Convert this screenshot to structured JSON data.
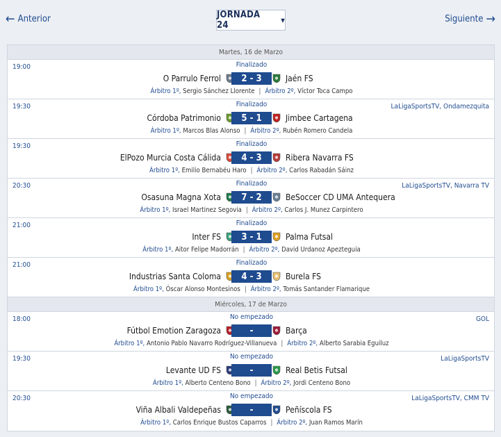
{
  "nav": {
    "prev_label": "Anterior",
    "next_label": "Siguiente",
    "round_label": "JORNADA 24"
  },
  "days": [
    {
      "label": "Martes, 16 de Marzo",
      "matches": [
        {
          "time": "19:00",
          "status": "Finalizado",
          "home": "O Parrulo Ferrol",
          "away": "Jaén FS",
          "score": "2 - 3",
          "tv": "",
          "ref1_label": "Árbitro 1º,",
          "ref1": "Sergio Sánchez Llorente",
          "ref2_label": "Árbitro 2º,",
          "ref2": "Víctor Toca Campo",
          "home_color": "#6b7a8c",
          "away_color": "#2a7a3a"
        },
        {
          "time": "19:30",
          "status": "Finalizado",
          "home": "Córdoba Patrimonio",
          "away": "Jimbee Cartagena",
          "score": "5 - 1",
          "tv": "LaLigaSportsTV, Ondamezquita",
          "ref1_label": "Árbitro 1º,",
          "ref1": "Marcos Blas Alonso",
          "ref2_label": "Árbitro 2º,",
          "ref2": "Rubén Romero Candela",
          "home_color": "#6a9a2c",
          "away_color": "#c0201f"
        },
        {
          "time": "19:30",
          "status": "Finalizado",
          "home": "ElPozo Murcia Costa Cálida",
          "away": "Ribera Navarra FS",
          "score": "4 - 3",
          "tv": "",
          "ref1_label": "Árbitro 1º,",
          "ref1": "Emilio Bernabéu Haro",
          "ref2_label": "Árbitro 2º,",
          "ref2": "Carlos Rabadán Sáinz",
          "home_color": "#d9493a",
          "away_color": "#b83a3a"
        },
        {
          "time": "20:30",
          "status": "Finalizado",
          "home": "Osasuna Magna Xota",
          "away": "BeSoccer CD UMA Antequera",
          "score": "7 - 2",
          "tv": "LaLigaSportsTV, Navarra TV",
          "ref1_label": "Árbitro 1º,",
          "ref1": "Israel Martinez Segovia",
          "ref2_label": "Árbitro 2º,",
          "ref2": "Carlos J. Munez Carpintero",
          "home_color": "#1e7a4a",
          "away_color": "#6a7f96"
        },
        {
          "time": "21:00",
          "status": "Finalizado",
          "home": "Inter FS",
          "away": "Palma Futsal",
          "score": "3 - 1",
          "tv": "",
          "ref1_label": "Árbitro 1º,",
          "ref1": "Aitor Felipe Madorrán",
          "ref2_label": "Árbitro 2º,",
          "ref2": "David Urdanoz Apezteguia",
          "home_color": "#3aa07a",
          "away_color": "#e0a020"
        },
        {
          "time": "21:00",
          "status": "Finalizado",
          "home": "Industrias Santa Coloma",
          "away": "Burela FS",
          "score": "4 - 3",
          "tv": "",
          "ref1_label": "Árbitro 1º,",
          "ref1": "Óscar Alonso Montesinos",
          "ref2_label": "Árbitro 2º,",
          "ref2": "Tomás Santander Flamarique",
          "home_color": "#d8a020",
          "away_color": "#e8c070"
        }
      ]
    },
    {
      "label": "Miércoles, 17 de Marzo",
      "matches": [
        {
          "time": "18:00",
          "status": "No empezado",
          "home": "Fútbol Emotion Zaragoza",
          "away": "Barça",
          "score": "-",
          "tv": "GOL",
          "ref1_label": "Árbitro 1º,",
          "ref1": "Antonio Pablo Navarro Rodríguez-Villanueva",
          "ref2_label": "Árbitro 2º,",
          "ref2": "Alberto Sarabia Eguiluz",
          "home_color": "#b8202a",
          "away_color": "#a01a3a"
        },
        {
          "time": "19:30",
          "status": "No empezado",
          "home": "Levante UD FS",
          "away": "Real Betis Futsal",
          "score": "-",
          "tv": "LaLigaSportsTV",
          "ref1_label": "Árbitro 1º,",
          "ref1": "Alberto Centeno Bono",
          "ref2_label": "Árbitro 2º,",
          "ref2": "Jordi Centeno Bono",
          "home_color": "#2a3a7a",
          "away_color": "#2a9a4a"
        },
        {
          "time": "20:30",
          "status": "No empezado",
          "home": "Viña Albali Valdepeñas",
          "away": "Peñíscola FS",
          "score": "-",
          "tv": "LaLigaSportsTV, CMM TV",
          "ref1_label": "Árbitro 1º,",
          "ref1": "Carlos Enrique Bustos Caparros",
          "ref2_label": "Árbitro 2º,",
          "ref2": "Juan Ramos Marín",
          "home_color": "#2a5a3a",
          "away_color": "#1f4b8f"
        }
      ]
    }
  ]
}
